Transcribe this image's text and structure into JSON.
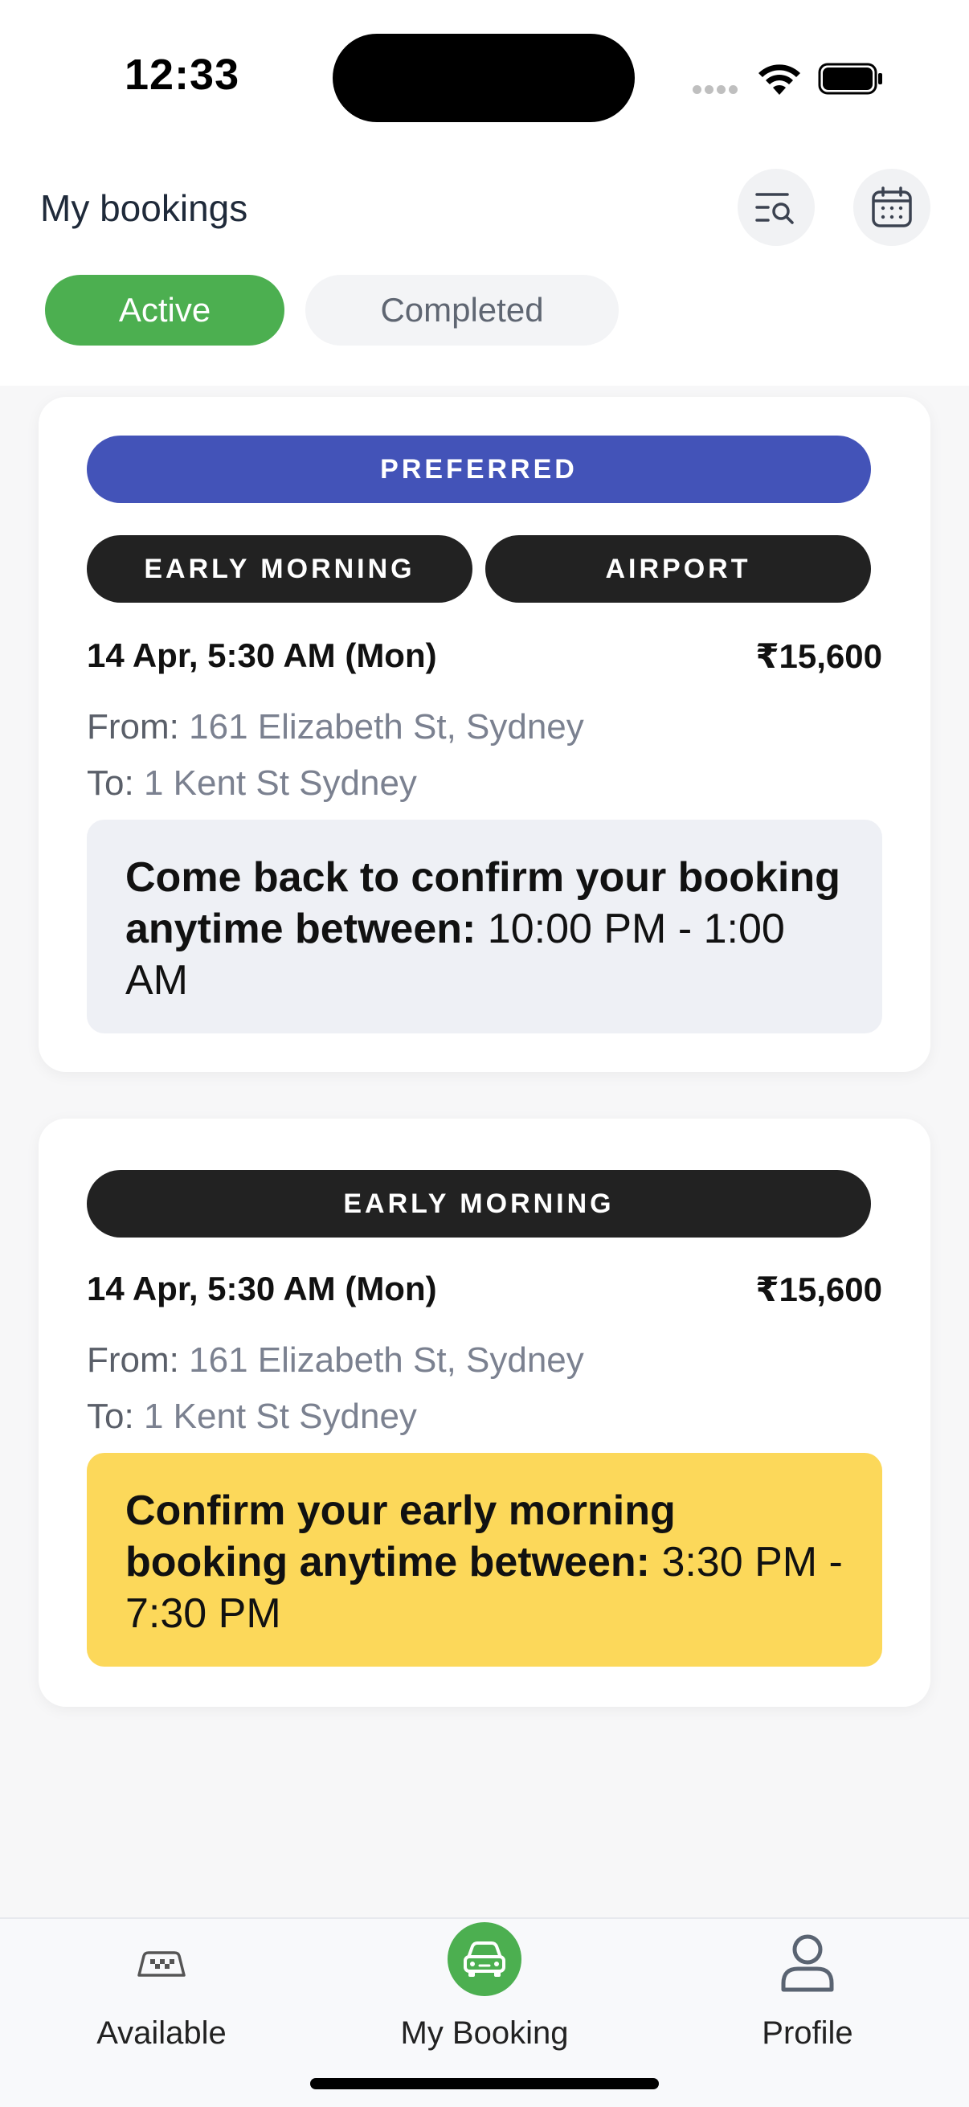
{
  "status_bar": {
    "time": "12:33"
  },
  "header": {
    "title": "My bookings",
    "search_icon": "list-search-icon",
    "calendar_icon": "calendar-icon"
  },
  "tabs": [
    {
      "label": "Active",
      "selected": true
    },
    {
      "label": "Completed",
      "selected": false
    }
  ],
  "bookings": [
    {
      "tags": [
        "PREFERRED",
        "EARLY MORNING",
        "AIRPORT"
      ],
      "datetime": "14 Apr, 5:30 AM (Mon)",
      "price": "₹15,600",
      "from_label": "From:",
      "from": "161 Elizabeth St, Sydney",
      "to_label": "To:",
      "to": "1 Kent St Sydney",
      "notice_bold": "Come back to confirm your booking anytime between:",
      "notice_time": "10:00 PM - 1:00 AM"
    },
    {
      "tags": [
        "EARLY MORNING"
      ],
      "datetime": "14 Apr, 5:30 AM (Mon)",
      "price": "₹15,600",
      "from_label": "From:",
      "from": "161 Elizabeth St, Sydney",
      "to_label": "To:",
      "to": "1 Kent St Sydney",
      "notice_bold": "Confirm your early morning booking anytime between:",
      "notice_time": "3:30 PM - 7:30 PM"
    }
  ],
  "bottom_nav": [
    {
      "label": "Available",
      "icon": "taxi-sign-icon"
    },
    {
      "label": "My Booking",
      "icon": "car-icon",
      "active": true
    },
    {
      "label": "Profile",
      "icon": "person-icon"
    }
  ],
  "colors": {
    "accent_green": "#4caf50",
    "preferred_blue": "#4353b8",
    "tag_dark": "#222222",
    "notice_grey": "#eef0f5",
    "notice_yellow": "#fcd85a"
  }
}
